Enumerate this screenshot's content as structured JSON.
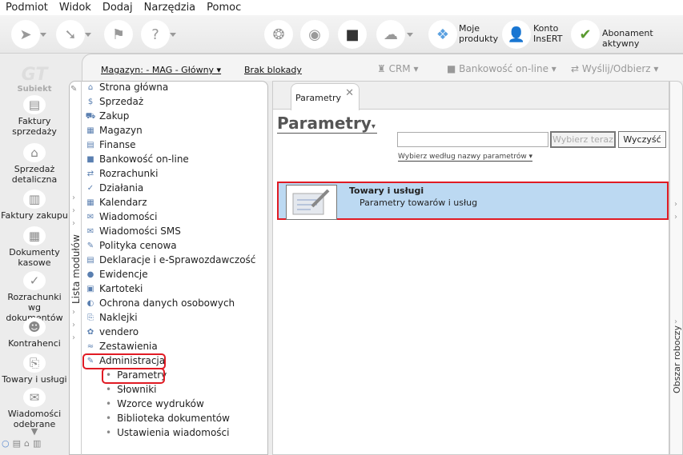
{
  "menu": [
    "Podmiot",
    "Widok",
    "Dodaj",
    "Narzędzia",
    "Pomoc"
  ],
  "toolbar": {
    "moje_produkty": [
      "Moje",
      "produkty"
    ],
    "konto": [
      "Konto",
      "InsERT"
    ],
    "abonament": "Abonament aktywny",
    "insert_badge": "InsERT"
  },
  "section_bar": {
    "magazyn": "Magazyn: - MAG - Główny ▾",
    "blokada": "Brak blokady",
    "crm": "CRM",
    "bankowosc": "Bankowość on-line",
    "wyslij": "Wyślij/Odbierz"
  },
  "logo": "Subiekt",
  "left_nav": [
    [
      "Faktury",
      "sprzedaży"
    ],
    [
      "Sprzedaż",
      "detaliczna"
    ],
    [
      "Faktury zakupu",
      ""
    ],
    [
      "Dokumenty",
      "kasowe"
    ],
    [
      "Rozrachunki wg",
      "dokumentów"
    ],
    [
      "Kontrahenci",
      ""
    ],
    [
      "Towary i usługi",
      ""
    ],
    [
      "Wiadomości",
      "odebrane"
    ]
  ],
  "module_list_label": "Lista modułów",
  "modules": [
    "Strona główna",
    "Sprzedaż",
    "Zakup",
    "Magazyn",
    "Finanse",
    "Bankowość on-line",
    "Rozrachunki",
    "Działania",
    "Kalendarz",
    "Wiadomości",
    "Wiadomości SMS",
    "Polityka cenowa",
    "Deklaracje i e-Sprawozdawczość",
    "Ewidencje",
    "Kartoteki",
    "Ochrona danych osobowych",
    "Naklejki",
    "vendero",
    "Zestawienia",
    "Administracja"
  ],
  "submodules": [
    "Parametry",
    "Słowniki",
    "Wzorce wydruków",
    "Biblioteka dokumentów",
    "Ustawienia wiadomości"
  ],
  "main": {
    "tab": "Parametry",
    "title": "Parametry",
    "search_value": "",
    "btn_select": "Wybierz teraz",
    "btn_clear": "Wyczyść",
    "filter_by": "Wybierz według nazwy parametrów ▾",
    "card_title": "Towary i usługi",
    "card_sub": "Parametry towarów i usług"
  },
  "right_panel": "Obszar roboczy",
  "colors": {
    "highlight": "#e01b24",
    "selected": "#bcd9f2"
  }
}
